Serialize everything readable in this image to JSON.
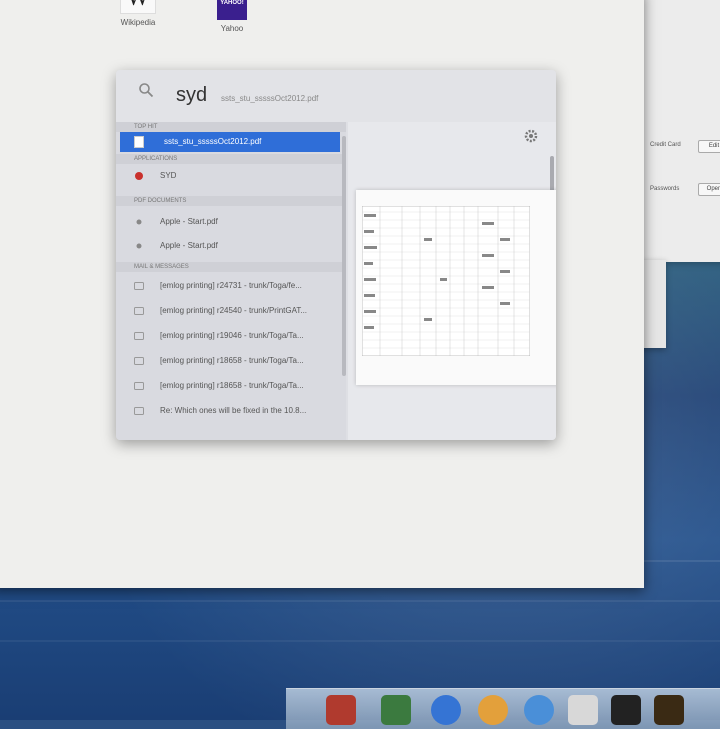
{
  "top_sites": [
    {
      "label": "Wikipedia",
      "glyph": "W"
    },
    {
      "label": "Yahoo",
      "glyph": "YAHOO!"
    }
  ],
  "spotlight": {
    "query": "syd",
    "query_hint": "ssts_stu_sssssOct2012.pdf",
    "sections": [
      {
        "header": "TOP HIT",
        "items": [
          "ssts_stu_sssssOct2012.pdf"
        ]
      },
      {
        "header": "APPLICATIONS",
        "items": [
          "SYD"
        ]
      },
      {
        "header": "PDF DOCUMENTS",
        "items": [
          "Apple - Start.pdf",
          "Apple - Start.pdf"
        ]
      },
      {
        "header": "MAIL & MESSAGES",
        "items": [
          "[emlog printing] r24731 - trunk/Toga/fe...",
          "[emlog printing] r24540 - trunk/PrintGAT...",
          "[emlog printing] r19046 - trunk/Toga/Ta...",
          "[emlog printing] r18658 - trunk/Toga/Ta...",
          "[emlog printing] r18658 - trunk/Toga/Ta...",
          "Re: Which ones will be fixed in the 10.8..."
        ]
      }
    ]
  },
  "right_window": {
    "rows": [
      "Credit Card",
      "",
      "Passwords"
    ],
    "buttons": [
      "Edit",
      "Open"
    ]
  },
  "colors": {
    "selection": "#2f6ed8",
    "window_bg": "#efefed",
    "spotlight_bg": "#dedfe4"
  }
}
